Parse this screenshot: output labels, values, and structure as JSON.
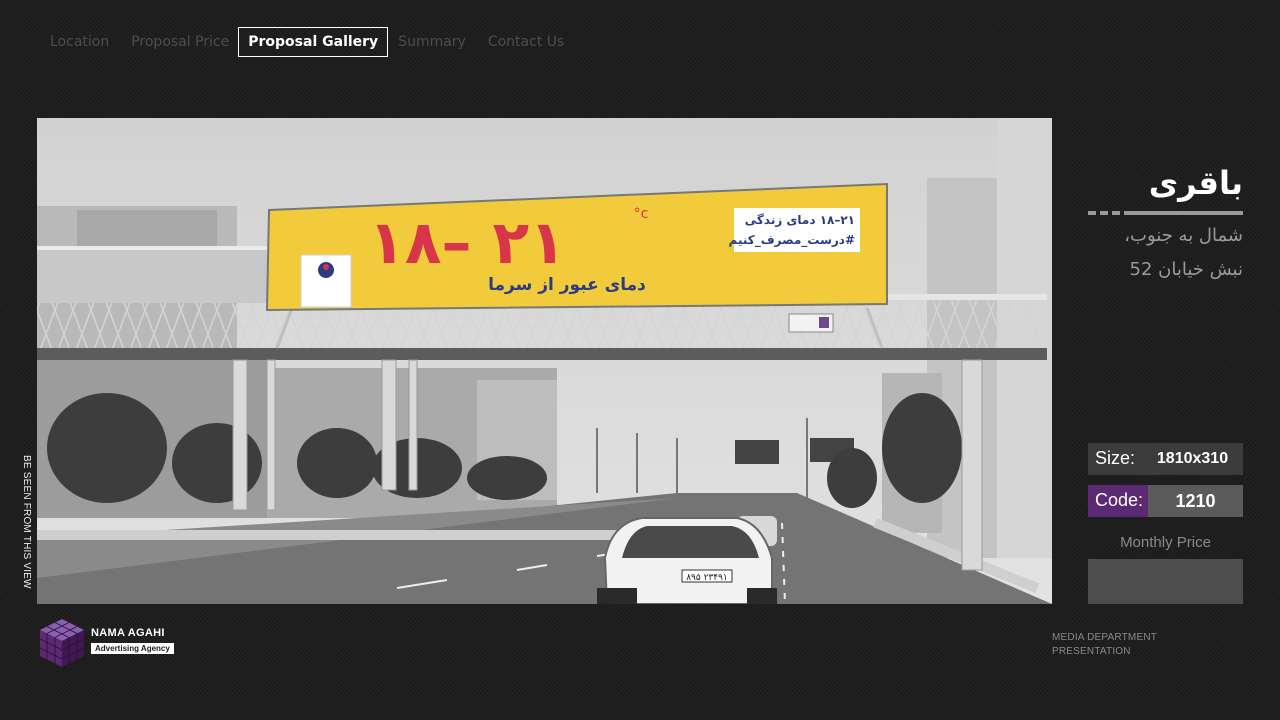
{
  "nav": {
    "items": [
      {
        "label": "Location",
        "active": false
      },
      {
        "label": "Proposal Price",
        "active": false
      },
      {
        "label": "Proposal Gallery",
        "active": true
      },
      {
        "label": "Summary",
        "active": false
      },
      {
        "label": "Contact Us",
        "active": false
      }
    ]
  },
  "photo": {
    "billboard_big": "۱۸– ۲۱",
    "billboard_unit": "°c",
    "billboard_sub": "دمای عبور از سرما",
    "billboard_box_line1": "۲۱–۱۸ دمای زندگی",
    "billboard_box_line2": "#درست_مصرف_کنیم",
    "plate": "۸۹۵ ۲۳۴۹۱"
  },
  "side_label": "BE SEEN FROM THIS VIEW",
  "info": {
    "title": "باقری",
    "address_line1": "شمال به جنوب،",
    "address_line2": "نبش خیابان 52",
    "size_label": "Size:",
    "size_value": "1810x310",
    "code_label": "Code:",
    "code_value": "1210",
    "monthly_label": "Monthly Price"
  },
  "logo": {
    "brand": "NAMA AGAHI",
    "tagline": "Advertising Agency"
  },
  "footer": {
    "line1": "MEDIA DEPARTMENT",
    "line2": "PRESENTATION"
  },
  "colors": {
    "accent_purple": "#5b2a72",
    "billboard_yellow": "#f2cb3c",
    "billboard_red": "#d8344a",
    "billboard_navy": "#2b3b85"
  }
}
